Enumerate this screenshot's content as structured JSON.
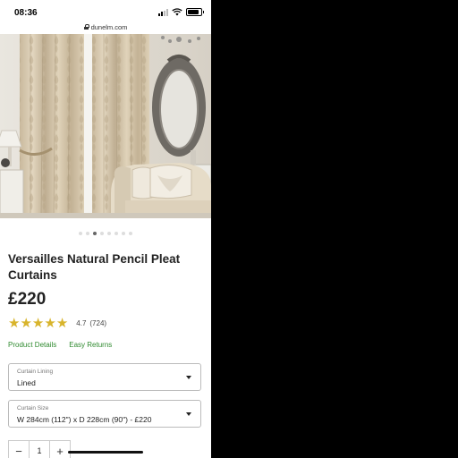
{
  "status_bar": {
    "time": "08:36",
    "battery_level": 0.85
  },
  "browser": {
    "url": "dunelm.com"
  },
  "gallery": {
    "image_count": 8,
    "active_index": 2
  },
  "product": {
    "title": "Versailles Natural Pencil Pleat Curtains",
    "price": "£220",
    "rating": {
      "stars": 5,
      "value": "4.7",
      "count": "(724)"
    },
    "links": [
      "Product Details",
      "Easy Returns"
    ]
  },
  "options": {
    "lining": {
      "label": "Curtain Lining",
      "value": "Lined"
    },
    "size": {
      "label": "Curtain Size",
      "value": "W 284cm (112\") x D 228cm (90\") - £220"
    }
  },
  "quantity": {
    "minus": "−",
    "value": "1",
    "plus": "+"
  },
  "colors": {
    "accent_green": "#2f8a2f",
    "star": "#d8b42c"
  }
}
